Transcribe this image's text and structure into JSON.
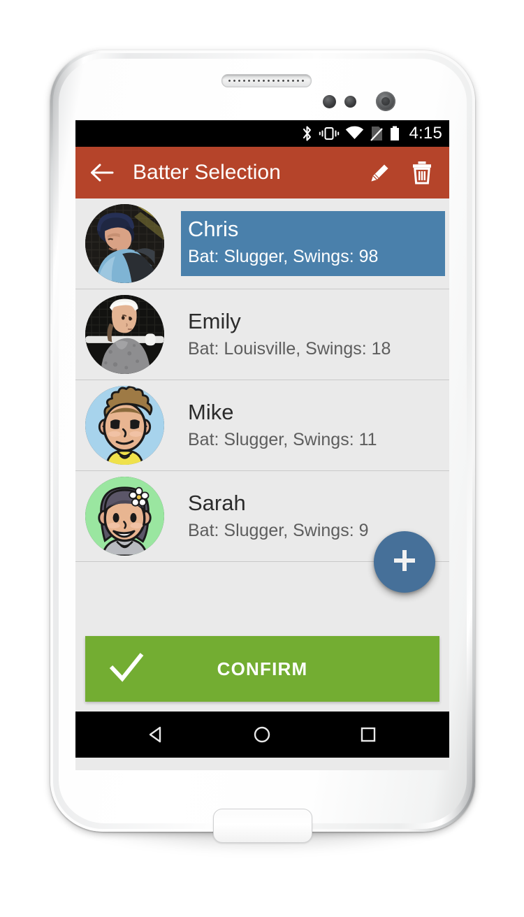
{
  "device": {
    "name": "white-android-smartphone",
    "home_button": "home-button"
  },
  "status_bar": {
    "time": "4:15",
    "icons": [
      "bluetooth-icon",
      "vibrate-icon",
      "wifi-icon",
      "no-sim-icon",
      "battery-icon"
    ],
    "background": "#000000"
  },
  "toolbar": {
    "title": "Batter Selection",
    "back_icon": "back-arrow-icon",
    "edit_icon": "pencil-icon",
    "delete_icon": "trash-icon",
    "background": "#b5442a",
    "text_color": "#ffffff"
  },
  "list": {
    "background": "#eaeaea",
    "selected_color": "#4a80ab",
    "divider_color": "#c9c9c9",
    "rows": [
      {
        "name": "Chris",
        "details": "Bat: Slugger, Swings: 98",
        "selected": true,
        "avatar": "photo-boy-batter-helmet"
      },
      {
        "name": "Emily",
        "details": "Bat: Louisville, Swings: 18",
        "selected": false,
        "avatar": "photo-girl-headband-bat"
      },
      {
        "name": "Mike",
        "details": "Bat: Slugger, Swings: 11",
        "selected": false,
        "avatar": "cartoon-boy-blue-background"
      },
      {
        "name": "Sarah",
        "details": "Bat: Slugger, Swings: 9",
        "selected": false,
        "avatar": "cartoon-girl-green-background"
      }
    ]
  },
  "fab": {
    "icon": "plus-icon",
    "color": "#467099",
    "label": "add-batter"
  },
  "confirm": {
    "label": "CONFIRM",
    "icon": "checkmark-icon",
    "color": "#73ad32"
  },
  "nav_bar": {
    "back": "back-triangle-icon",
    "home": "home-circle-icon",
    "recents": "recents-square-icon",
    "background": "#000000"
  }
}
